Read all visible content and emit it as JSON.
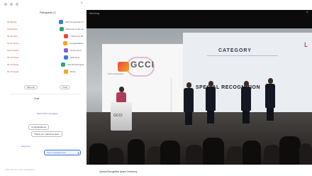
{
  "panel": {
    "title": "Participants (7)",
    "rows": [
      {
        "meta": "01:08  Org",
        "tag_color": "#3a7bd5",
        "text": "Gulf Cooperation Council"
      },
      {
        "meta": "01:09  Host",
        "tag_color": "#2aa876",
        "text": "Welcome to the session"
      },
      {
        "meta": "01:10  Host",
        "tag_color": "#e8463a",
        "text": "Thank you all"
      },
      {
        "meta": "01:11  Guest",
        "tag_color": "#f5a623",
        "text": "Congratulations"
      },
      {
        "meta": "01:12  Guest",
        "tag_color": "#8a5cd6",
        "text": "Great event"
      },
      {
        "meta": "01:13  Guest",
        "tag_color": "#3a7bd5",
        "text": "Well done"
      },
      {
        "meta": "01:14  Guest",
        "tag_color": "#2aa876",
        "text": "Special Recognition"
      },
      {
        "meta": "01:15  Guest",
        "tag_color": "#f5a623",
        "text": "Bravo"
      }
    ],
    "btn_left": "Mute All",
    "btn_right": "Invite",
    "chat_heading": "Chat",
    "link_top": "Show older messages",
    "bubble_1": "Congratulations",
    "bubble_2": "Thank you, well done team",
    "link_mid": "Everyone",
    "input_placeholder": "Type message here...",
    "send_icon": "send-icon",
    "footer": "Who can see your messages?"
  },
  "video": {
    "title": "Meeting",
    "close": "×",
    "screen_left_logo": "GCCI",
    "screen_left_sub": "Gulf Cooperation",
    "screen_right_category": "CATEGORY",
    "screen_right_headline": "SPECIAL RECOGNITION",
    "screen_right_mark": "L",
    "lectern_logo": "GCCI"
  },
  "caption": "Special Recognition Award Ceremony"
}
